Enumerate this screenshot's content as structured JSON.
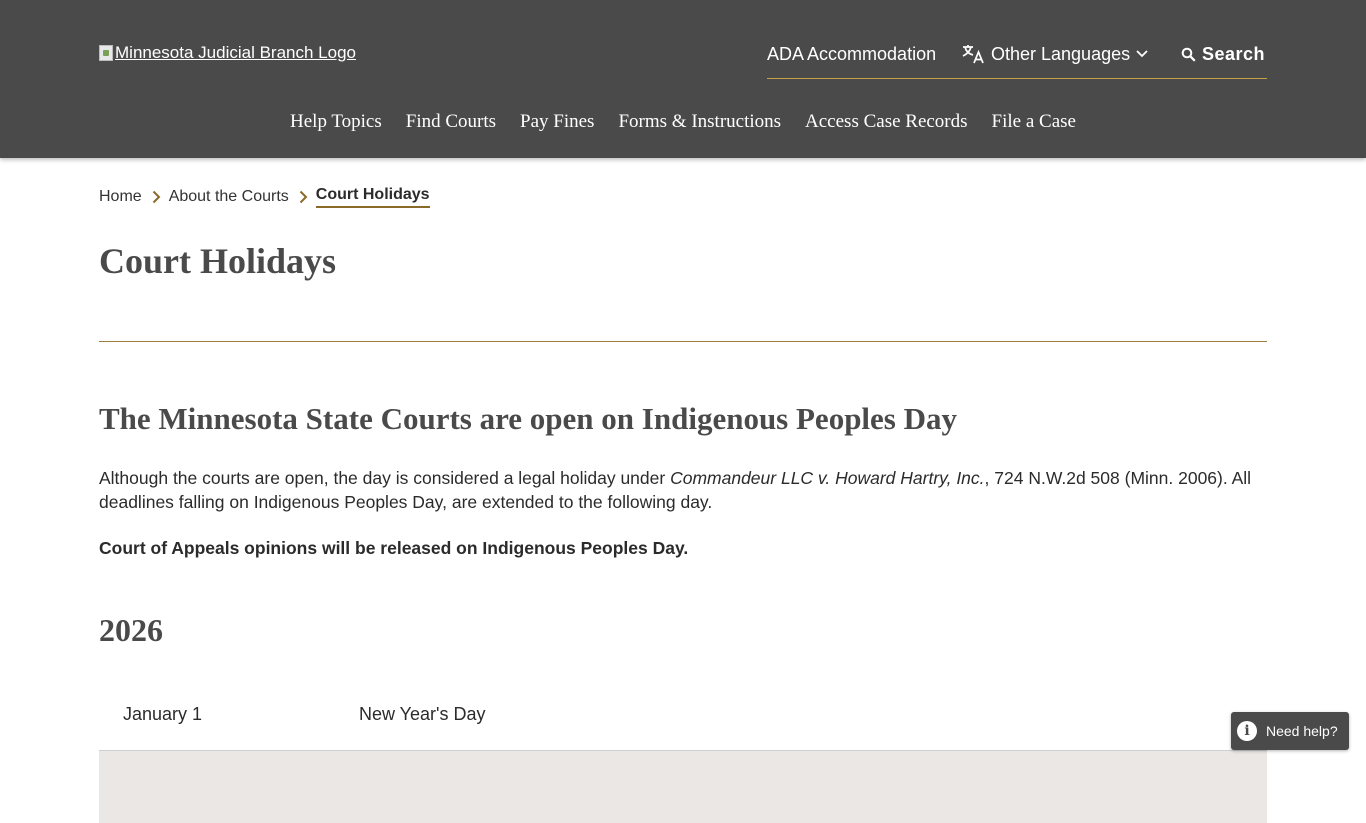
{
  "header": {
    "logo_alt": "Minnesota Judicial Branch Logo",
    "utility": {
      "ada": "ADA Accommodation",
      "languages": "Other Languages",
      "search": "Search"
    },
    "nav": [
      "Help Topics",
      "Find Courts",
      "Pay Fines",
      "Forms & Instructions",
      "Access Case Records",
      "File a Case"
    ]
  },
  "breadcrumb": {
    "home": "Home",
    "about": "About the Courts",
    "current": "Court Holidays"
  },
  "page": {
    "title": "Court Holidays",
    "section_heading": "The Minnesota State Courts are open on Indigenous Peoples Day",
    "para_pre": "Although the courts are open, the day is considered a legal holiday under ",
    "para_case": "Commandeur LLC v. Howard Hartry, Inc.",
    "para_post": ", 724 N.W.2d 508 (Minn. 2006). All deadlines falling on Indigenous Peoples Day, are extended to the following day.",
    "para_bold": "Court of Appeals opinions will be released on Indigenous Peoples Day.",
    "year": "2026"
  },
  "holidays": [
    {
      "date": "January 1",
      "name": "New Year's Day"
    },
    {
      "date": "",
      "name": ""
    }
  ],
  "help": {
    "label": "Need help?"
  },
  "colors": {
    "header_bg": "#4a4a4a",
    "accent_gold": "#9c7d3c",
    "row_alt": "#ebe7e4"
  }
}
